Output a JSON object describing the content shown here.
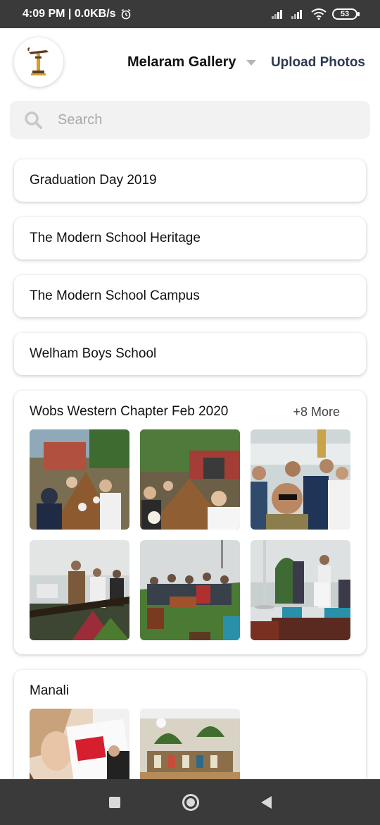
{
  "status_bar": {
    "time_speed": "4:09 PM | 0.0KB/s",
    "battery": "53"
  },
  "header": {
    "gallery_name": "Melaram Gallery",
    "upload_label": "Upload Photos"
  },
  "search": {
    "placeholder": "Search"
  },
  "albums": [
    {
      "title": "Graduation Day 2019"
    },
    {
      "title": "The Modern School Heritage"
    },
    {
      "title": "The Modern School Campus"
    },
    {
      "title": "Welham Boys School"
    },
    {
      "title": "Wobs Western Chapter Feb 2020",
      "more": "+8 More"
    },
    {
      "title": "Manali"
    }
  ],
  "colors": {
    "accent": "#2d3a52",
    "bar": "#3a3a3a"
  }
}
